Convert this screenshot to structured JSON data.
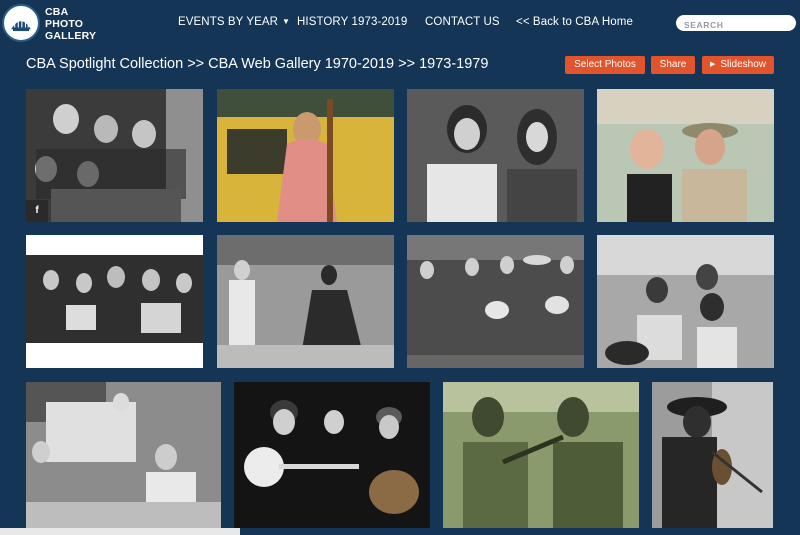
{
  "brand": {
    "line1": "CBA",
    "line2": "PHOTO",
    "line3": "GALLERY"
  },
  "nav": {
    "events": "EVENTS BY YEAR",
    "history": "HISTORY 1973-2019",
    "contact": "CONTACT US",
    "back": "<< Back to CBA Home"
  },
  "search": {
    "placeholder": "SEARCH"
  },
  "breadcrumb": "CBA Spotlight Collection >> CBA Web Gallery 1970-2019 >> 1973-1979",
  "actions": {
    "select": "Select Photos",
    "share": "Share",
    "slideshow": "Slideshow"
  },
  "photo_share_icon": "f",
  "colors": {
    "background": "#143556",
    "accent": "#e2542b"
  },
  "icons": [
    "logo-emblem",
    "chevron-down-icon",
    "facebook-icon",
    "play-icon"
  ]
}
